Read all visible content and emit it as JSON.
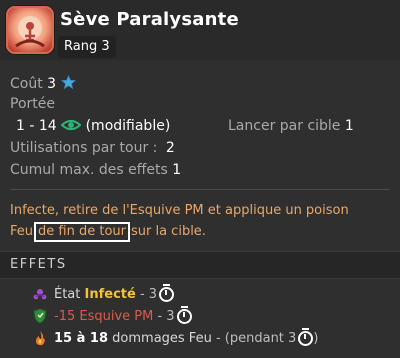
{
  "spell": {
    "title": "Sève Paralysante",
    "rank": "Rang 3"
  },
  "stats": {
    "cost_label": "Coût",
    "cost_value": "3",
    "range_label": "Portée",
    "range_value": "1 - 14",
    "range_note": "(modifiable)",
    "casts_per_target_label": "Lancer par cible",
    "casts_per_target_value": "1",
    "uses_per_turn_label": "Utilisations par tour :",
    "uses_per_turn_value": "2",
    "max_stack_label": "Cumul max. des effets",
    "max_stack_value": "1"
  },
  "description": {
    "line1": "Infecte, retire de l'Esquive PM et applique un poison",
    "line2_prefix": "Feu",
    "line2_highlight": "de fin de tour",
    "line2_suffix": "sur la cible."
  },
  "effects": {
    "title": "EFFETS",
    "items": [
      {
        "prefix": "État",
        "highlight": "Infecté",
        "duration": "- 3"
      },
      {
        "highlight": "-15 Esquive PM",
        "duration": "- 3"
      },
      {
        "amount": "15 à 18",
        "text": "dommages Feu",
        "duration": "- (pendant 3",
        "close": ")"
      }
    ]
  },
  "colors": {
    "background": "#2f2f2f",
    "description_orange": "#e8a86b",
    "infected_yellow": "#f2c23c",
    "negative_red": "#e05a4c",
    "star_blue": "#4aa8e0",
    "eye_green": "#2bb37a"
  },
  "icons": {
    "spell": "spell-paralyzing-sap-icon",
    "cost": "star-icon",
    "range": "eye-icon",
    "effect1": "infected-icon",
    "effect2": "shield-icon",
    "effect3": "fire-icon",
    "duration": "clock-icon"
  }
}
